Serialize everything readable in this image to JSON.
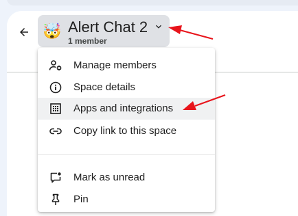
{
  "header": {
    "title": "Alert Chat 2",
    "member_count": "1 member",
    "avatar_emoji": "🤯",
    "back_icon": "arrow-back-icon",
    "dropdown_icon": "chevron-down-icon"
  },
  "menu": {
    "items": [
      {
        "label": "Manage members",
        "icon": "manage-members-icon",
        "highlighted": false
      },
      {
        "label": "Space details",
        "icon": "info-icon",
        "highlighted": false
      },
      {
        "label": "Apps and integrations",
        "icon": "apps-grid-icon",
        "highlighted": true
      },
      {
        "label": "Copy link to this space",
        "icon": "link-icon",
        "highlighted": false
      },
      {
        "label": "Mark as unread",
        "icon": "mark-unread-icon",
        "highlighted": false
      },
      {
        "label": "Pin",
        "icon": "pin-icon",
        "highlighted": false
      }
    ]
  },
  "colors": {
    "background": "#eef3fb",
    "panel": "#ffffff",
    "header_chip": "#dfe1e5",
    "highlight": "#f0f1f2",
    "annotation_arrow": "#e8141b",
    "text": "#1f1f1f"
  }
}
